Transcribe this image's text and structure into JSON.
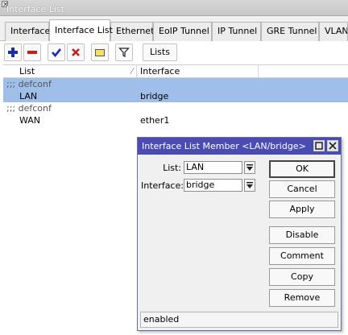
{
  "window": {
    "title": "Interface List"
  },
  "tabs": [
    {
      "label": "Interface"
    },
    {
      "label": "Interface List"
    },
    {
      "label": "Ethernet"
    },
    {
      "label": "EoIP Tunnel"
    },
    {
      "label": "IP Tunnel"
    },
    {
      "label": "GRE Tunnel"
    },
    {
      "label": "VLAN"
    }
  ],
  "toolbar": {
    "add_icon": "plus-icon",
    "remove_icon": "minus-icon",
    "enable_icon": "check-icon",
    "disable_icon": "x-icon",
    "comment_icon": "note-icon",
    "filter_icon": "filter-icon",
    "lists_label": "Lists"
  },
  "list": {
    "columns": [
      "List",
      "Interface"
    ],
    "rows": [
      {
        "type": "comment",
        "text": ";;; defconf",
        "selected": true
      },
      {
        "type": "item",
        "list": "LAN",
        "interface": "bridge",
        "selected": true
      },
      {
        "type": "comment",
        "text": ";;; defconf",
        "selected": false
      },
      {
        "type": "item",
        "list": "WAN",
        "interface": "ether1",
        "selected": false
      }
    ]
  },
  "dialog": {
    "title": "Interface List Member <LAN/bridge>",
    "fields": {
      "list_label": "List:",
      "list_value": "LAN",
      "interface_label": "Interface:",
      "interface_value": "bridge"
    },
    "buttons": {
      "ok": "OK",
      "cancel": "Cancel",
      "apply": "Apply",
      "disable": "Disable",
      "comment": "Comment",
      "copy": "Copy",
      "remove": "Remove"
    },
    "status": "enabled"
  },
  "colors": {
    "selection": "#9fbfe8",
    "dialog_title": "#4a4cb2",
    "add_icon": "#1a2fa8",
    "remove_icon": "#c81e1e",
    "enable_icon": "#1a2fa8",
    "disable_icon": "#c81e1e",
    "comment_icon": "#f6e25a"
  }
}
